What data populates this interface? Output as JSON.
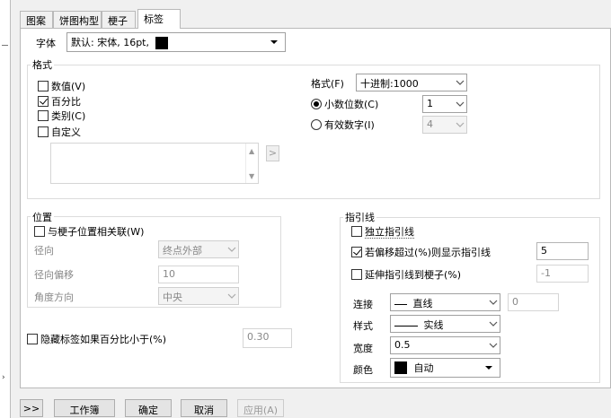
{
  "tabs": [
    "图案",
    "饼图构型",
    "梗子",
    "标签"
  ],
  "font": {
    "label": "字体",
    "value": "默认: 宋体, 16pt,"
  },
  "format_group": {
    "title": "格式",
    "checkboxes": [
      {
        "label": "数值(V)",
        "checked": false
      },
      {
        "label": "百分比",
        "checked": true
      },
      {
        "label": "类别(C)",
        "checked": false
      },
      {
        "label": "自定义",
        "checked": false
      }
    ],
    "format_label": "格式(F)",
    "format_value": "十进制:1000",
    "decimal_radio_label": "小数位数(C)",
    "decimal_value": "1",
    "sig_radio_label": "有效数字(I)",
    "sig_value": "4",
    "move_button": ">"
  },
  "position_group": {
    "title": "位置",
    "relate_label": "与梗子位置相关联(W)",
    "radial_label": "径向",
    "radial_value": "终点外部",
    "radial_offset_label": "径向偏移",
    "radial_offset_value": "10",
    "angle_label": "角度方向",
    "angle_value": "中央"
  },
  "hide": {
    "label": "隐藏标签如果百分比小于(%)",
    "value": "0.30"
  },
  "leader_group": {
    "title": "指引线",
    "independent_label": "独立指引线",
    "offset_label": "若偏移超过(%)则显示指引线",
    "offset_value": "5",
    "extend_label": "延伸指引线到梗子(%)",
    "extend_value": "-1",
    "connect_label": "连接",
    "connect_value": "直线",
    "connect_num": "0",
    "style_label": "样式",
    "style_value": "实线",
    "width_label": "宽度",
    "width_value": "0.5",
    "color_label": "颜色",
    "color_value": "自动"
  },
  "footer": {
    "expand": ">>",
    "workbook": "工作簿",
    "ok": "确定",
    "cancel": "取消",
    "apply": "应用(A)"
  }
}
